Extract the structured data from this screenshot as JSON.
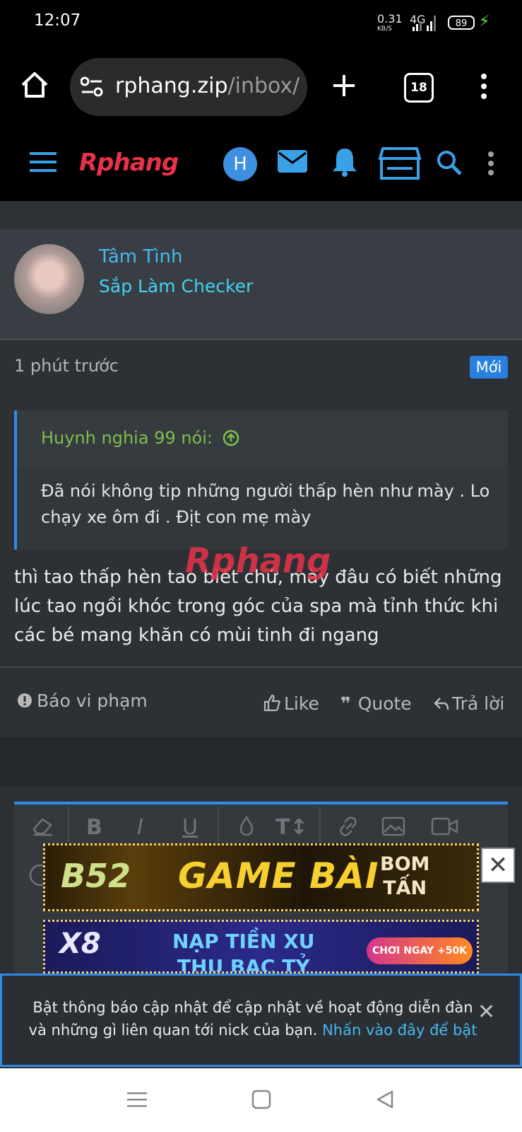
{
  "status_bar": {
    "time": "12:07",
    "net_speed": "0.31",
    "net_unit": "KB/S",
    "network": "4G",
    "battery": "89"
  },
  "browser": {
    "url_host": "rphang.zip",
    "url_path": "/inbox/",
    "tab_count": "18"
  },
  "forum_header": {
    "logo": "Rphang",
    "avatar_letter": "H"
  },
  "post": {
    "user_name": "Tâm Tình",
    "user_title": "Sắp Làm Checker",
    "time": "1 phút trước",
    "badge": "Mới",
    "quote_author": "Huynh nghia 99 nói:",
    "quote_text": "Đã nói không tip những người thấp hèn như mày . Lo chạy xe ôm đi . Địt con mẹ mày",
    "message": "thì tao thấp hèn tao biết chứ, mày đâu có biết những lúc tao ngồi khóc trong góc của spa mà tỉnh thức khi các bé mang khăn có mùi tinh đi ngang",
    "watermark": "Rphang"
  },
  "actions": {
    "report": "Báo vi phạm",
    "like": "Like",
    "quote": "Quote",
    "reply": "Trả lời"
  },
  "ads": {
    "ad1_brand": "B52",
    "ad1_title": "GAME BÀI",
    "ad1_tag_1": "BOM",
    "ad1_tag_2": "TẤN",
    "ad2_brand": "X8",
    "ad2_line1": "NẠP TIỀN XU",
    "ad2_line2": "THU BẠC TỶ",
    "ad2_cta": "CHƠI NGAY +50K"
  },
  "notification": {
    "text": "Bật thông báo cập nhật để cập nhật về hoạt động diễn đàn và những gì liên quan tới nick của bạn.",
    "link": "Nhấn vào đây để bật"
  },
  "colors": {
    "accent": "#2f8ae6",
    "username": "#48b8f0",
    "quote_author": "#7fbf4a"
  }
}
